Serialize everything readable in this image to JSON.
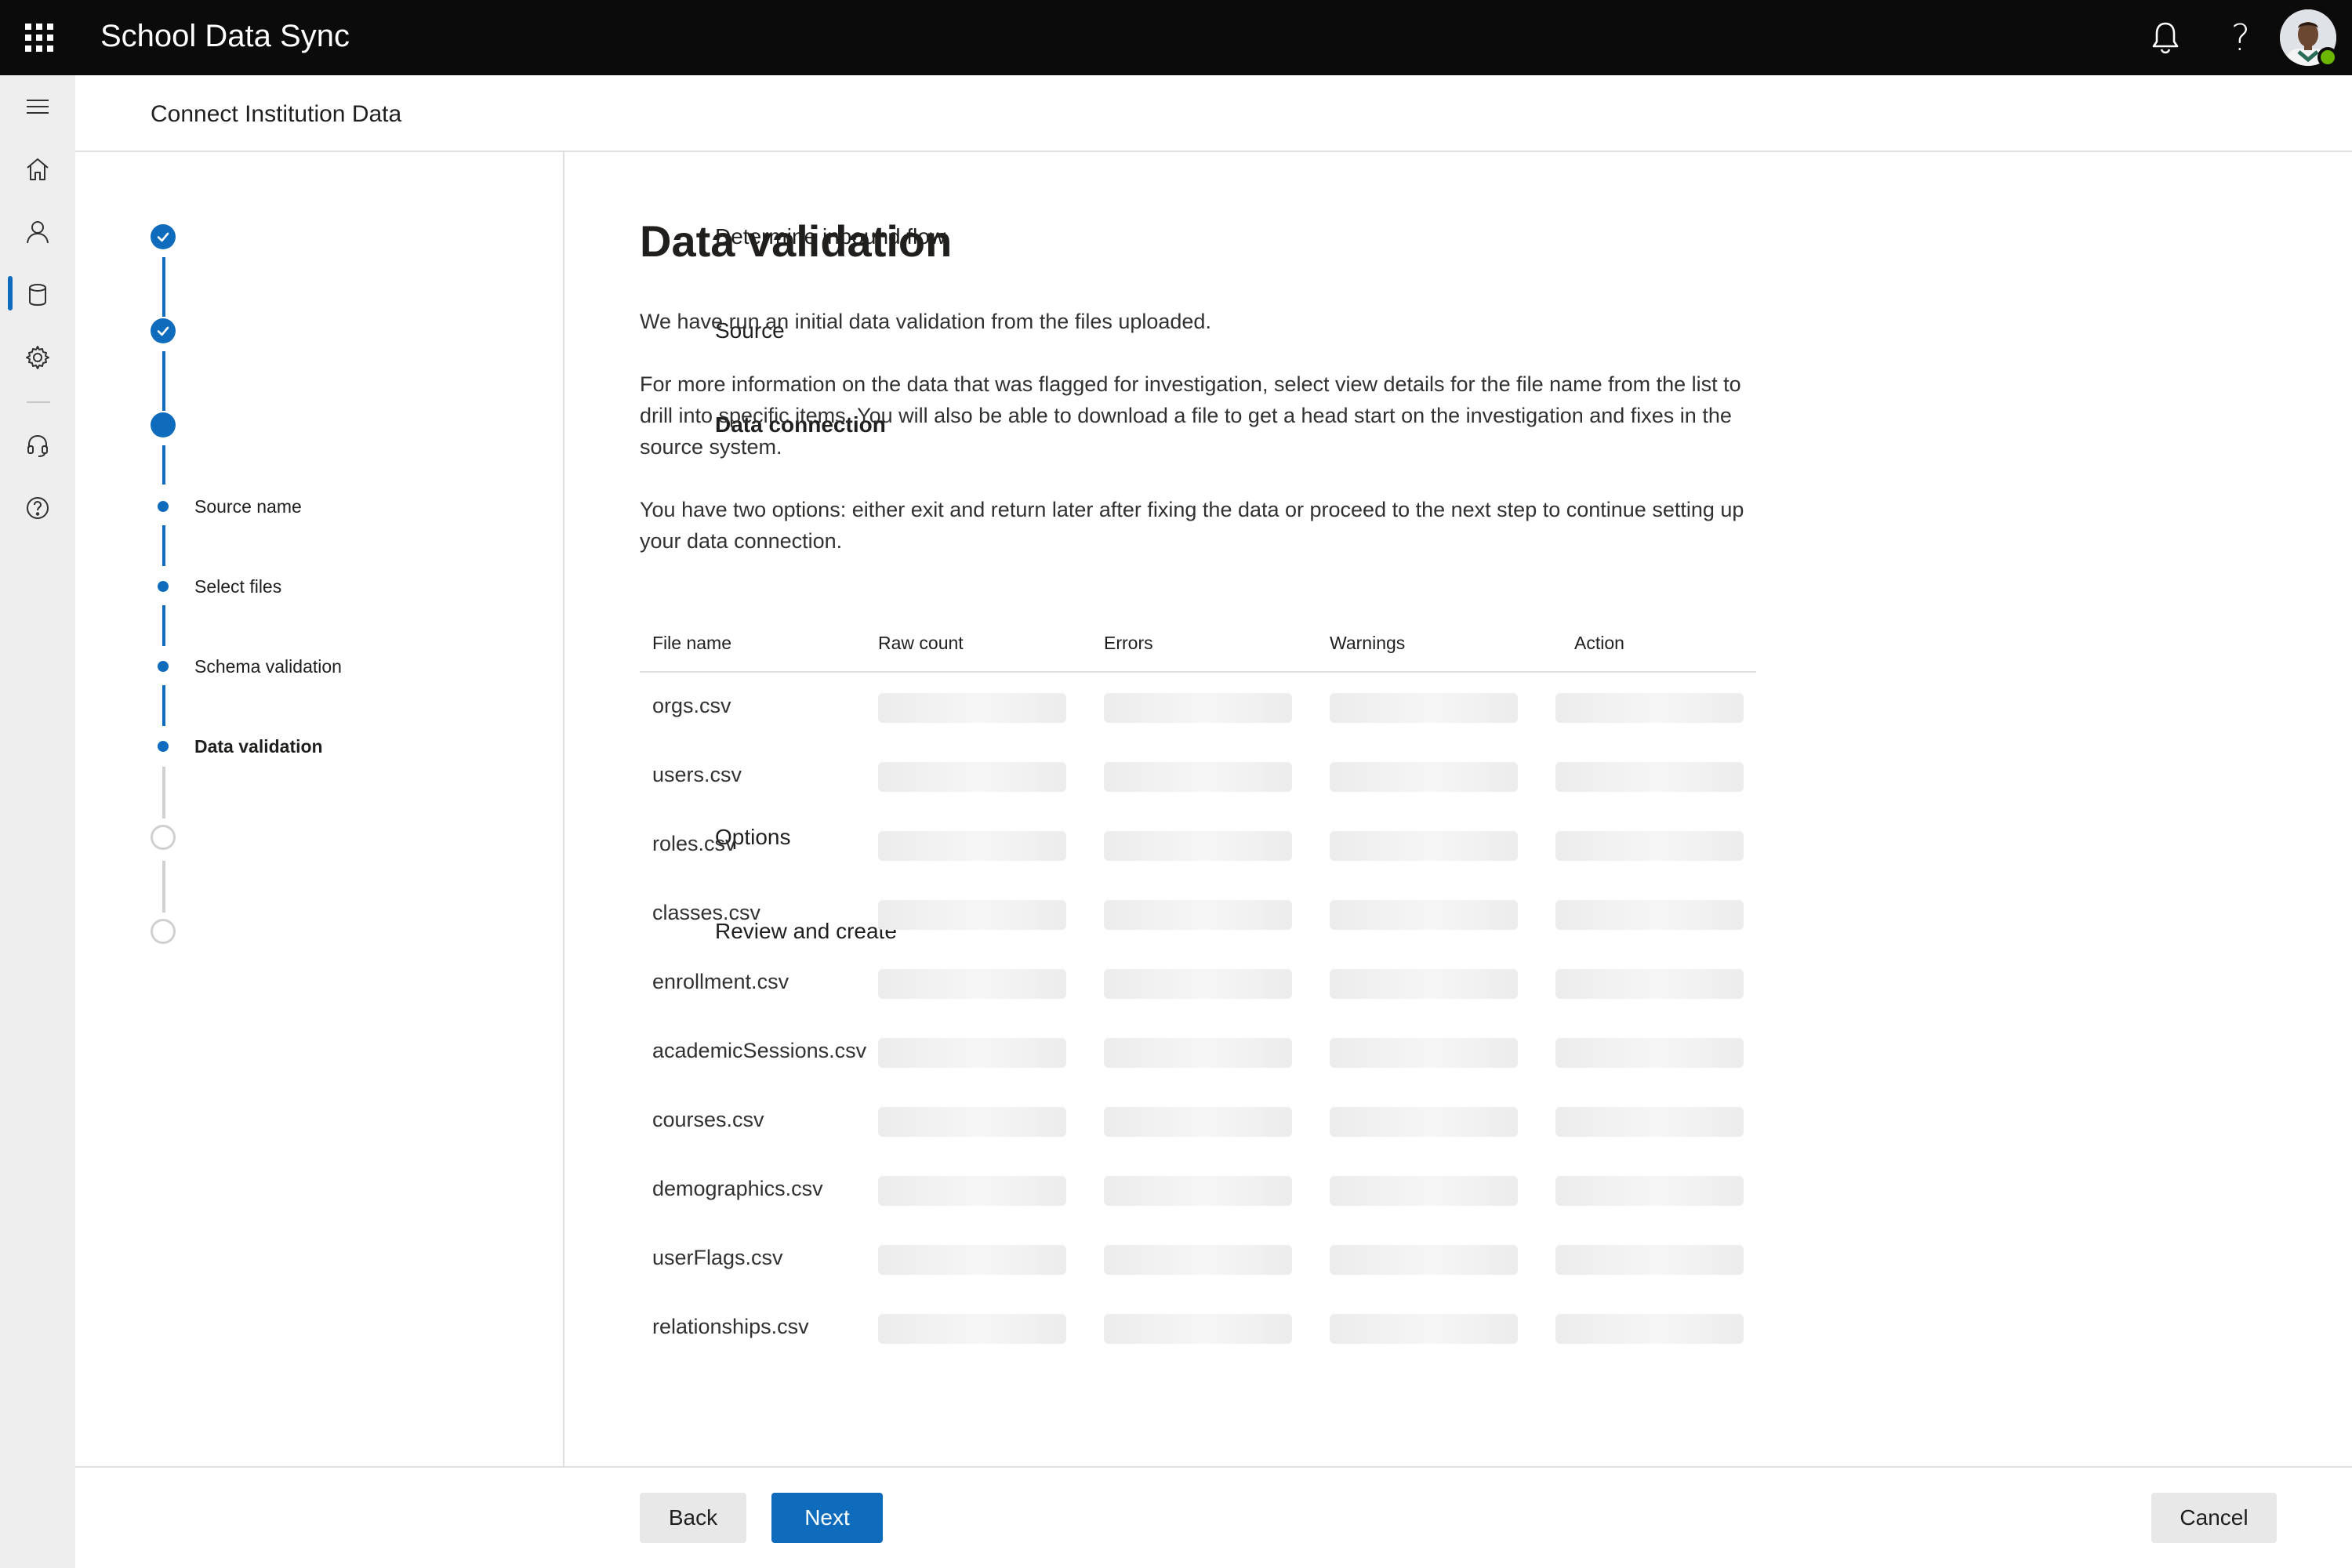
{
  "app": {
    "title": "School Data Sync"
  },
  "icons": {
    "waffle": "app-launcher-icon",
    "bell": "notification-bell-icon",
    "help": "help-question-icon",
    "avatar": "user-avatar"
  },
  "help_glyph": "?",
  "rail": [
    {
      "name": "menu-icon"
    },
    {
      "name": "home-icon"
    },
    {
      "name": "person-icon"
    },
    {
      "name": "database-icon",
      "active": true
    },
    {
      "name": "settings-gear-icon"
    },
    {
      "name": "headset-support-icon"
    },
    {
      "name": "help-circle-icon"
    }
  ],
  "header": {
    "title": "Connect Institution Data"
  },
  "stepper": {
    "steps": [
      {
        "label": "Determine inbound flow",
        "state": "done"
      },
      {
        "label": "Source",
        "state": "done"
      },
      {
        "label": "Data connection",
        "state": "current"
      },
      {
        "label": "Source name",
        "state": "sub"
      },
      {
        "label": "Select files",
        "state": "sub"
      },
      {
        "label": "Schema validation",
        "state": "sub"
      },
      {
        "label": "Data validation",
        "state": "sub-current"
      },
      {
        "label": "Options",
        "state": "todo"
      },
      {
        "label": "Review and create",
        "state": "todo"
      }
    ]
  },
  "main": {
    "title": "Data validation",
    "para1": "We have run an initial data validation from the files uploaded.",
    "para2": "For more information on the data that was flagged for investigation, select view details for the file name from the list to drill into specific items. You will also be able to download a file to get a head start on the investigation and fixes in the source system.",
    "para3": "You have two options: either exit and return later after fixing the data or proceed to the next step to continue setting up your data connection."
  },
  "table": {
    "columns": [
      "File name",
      "Raw count",
      "Errors",
      "Warnings",
      "Action"
    ],
    "rows": [
      "orgs.csv",
      "users.csv",
      "roles.csv",
      "classes.csv",
      "enrollment.csv",
      "academicSessions.csv",
      "courses.csv",
      "demographics.csv",
      "userFlags.csv",
      "relationships.csv"
    ],
    "loading": true
  },
  "footer": {
    "back": "Back",
    "next": "Next",
    "cancel": "Cancel"
  },
  "colors": {
    "accent": "#0f6cbd",
    "topbar": "#0b0b0b",
    "presence": "#6bb700"
  }
}
